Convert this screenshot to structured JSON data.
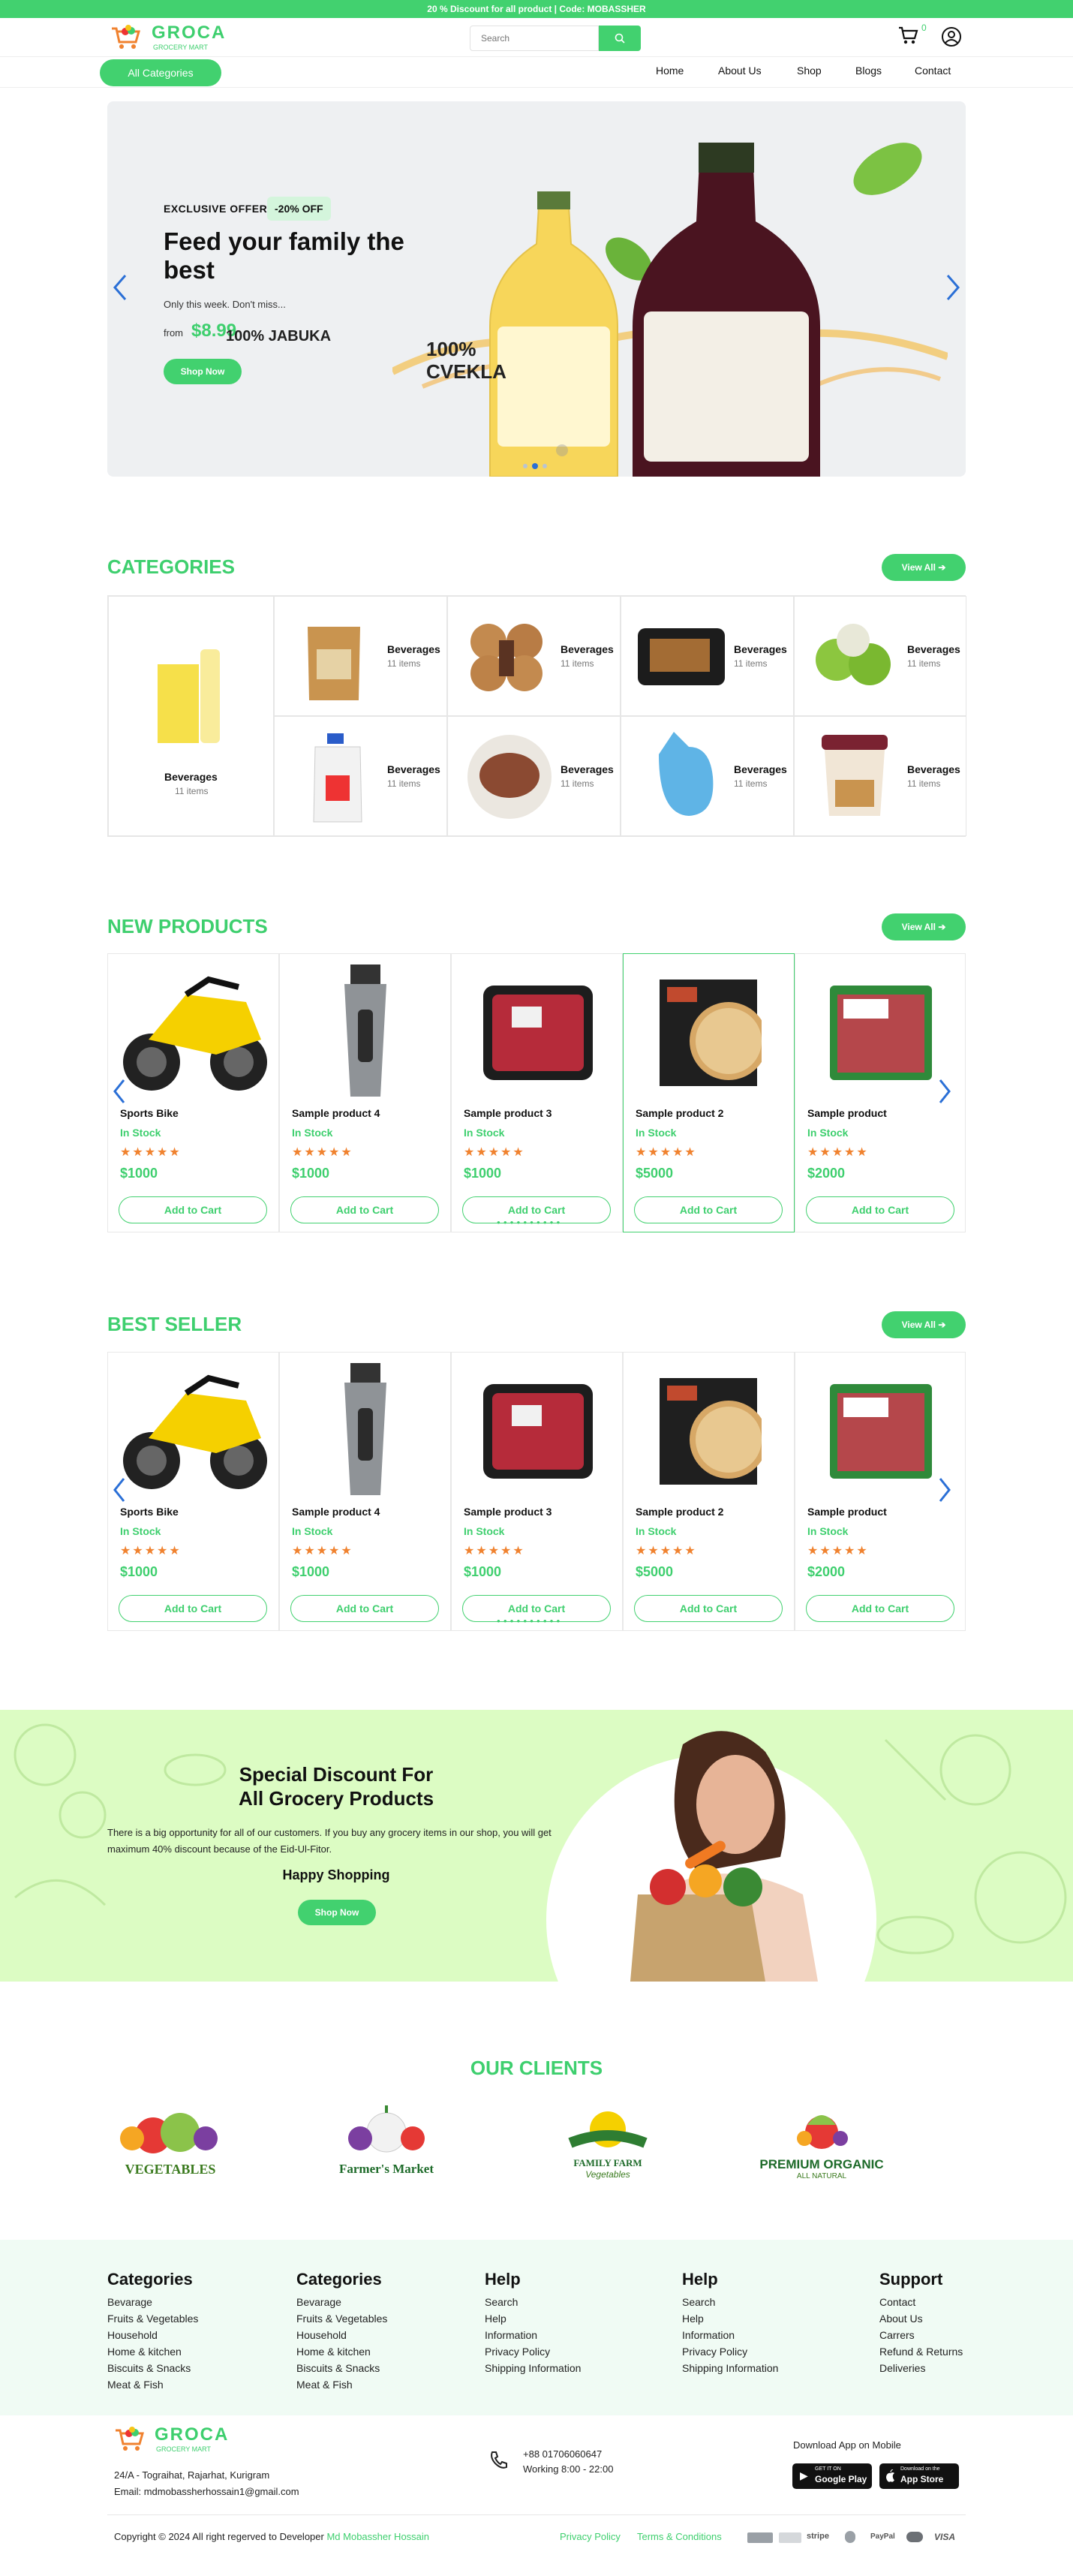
{
  "topbar": {
    "text": "20 % Discount for all product | Code: MOBASSHER"
  },
  "brand": {
    "name": "GROCA",
    "tagline": "GROCERY MART"
  },
  "search": {
    "placeholder": "Search"
  },
  "cart": {
    "count": "0"
  },
  "nav": {
    "all_categories": "All Categories",
    "links": [
      "Home",
      "About Us",
      "Shop",
      "Blogs",
      "Contact"
    ]
  },
  "hero": {
    "offer": "EXCLUSIVE OFFER",
    "badge": "-20% OFF",
    "title": "Feed your family the best",
    "subtitle": "Only this week. Don't miss...",
    "from_label": "from",
    "price": "$8.99",
    "button": "Shop Now",
    "bottle_left_text": "100% JABUKA",
    "bottle_right_text": "100% CVEKLA"
  },
  "categories": {
    "title": "CATEGORIES",
    "view_all": "View All",
    "items": [
      {
        "name": "Beverages",
        "count": "11 items"
      },
      {
        "name": "Beverages",
        "count": "11 items"
      },
      {
        "name": "Beverages",
        "count": "11 items"
      },
      {
        "name": "Beverages",
        "count": "11 items"
      },
      {
        "name": "Beverages",
        "count": "11 items"
      },
      {
        "name": "Beverages",
        "count": "11 items"
      },
      {
        "name": "Beverages",
        "count": "11 items"
      },
      {
        "name": "Beverages",
        "count": "11 items"
      },
      {
        "name": "Beverages",
        "count": "11 items"
      }
    ]
  },
  "new_products": {
    "title": "NEW PRODUCTS",
    "view_all": "View All",
    "items": [
      {
        "name": "Sports Bike",
        "stock": "In Stock",
        "stars": "★★★★★",
        "price": "$1000",
        "button": "Add to Cart"
      },
      {
        "name": "Sample product 4",
        "stock": "In Stock",
        "stars": "★★★★★",
        "price": "$1000",
        "button": "Add to Cart"
      },
      {
        "name": "Sample product 3",
        "stock": "In Stock",
        "stars": "★★★★★",
        "price": "$1000",
        "button": "Add to Cart"
      },
      {
        "name": "Sample product 2",
        "stock": "In Stock",
        "stars": "★★★★★",
        "price": "$5000",
        "button": "Add to Cart"
      },
      {
        "name": "Sample product",
        "stock": "In Stock",
        "stars": "★★★★★",
        "price": "$2000",
        "button": "Add to Cart"
      }
    ]
  },
  "best_seller": {
    "title": "BEST SELLER",
    "view_all": "View All",
    "items": [
      {
        "name": "Sports Bike",
        "stock": "In Stock",
        "stars": "★★★★★",
        "price": "$1000",
        "button": "Add to Cart"
      },
      {
        "name": "Sample product 4",
        "stock": "In Stock",
        "stars": "★★★★★",
        "price": "$1000",
        "button": "Add to Cart"
      },
      {
        "name": "Sample product 3",
        "stock": "In Stock",
        "stars": "★★★★★",
        "price": "$1000",
        "button": "Add to Cart"
      },
      {
        "name": "Sample product 2",
        "stock": "In Stock",
        "stars": "★★★★★",
        "price": "$5000",
        "button": "Add to Cart"
      },
      {
        "name": "Sample product",
        "stock": "In Stock",
        "stars": "★★★★★",
        "price": "$2000",
        "button": "Add to Cart"
      }
    ]
  },
  "promo": {
    "title_line1": "Special Discount For",
    "title_line2": "All Grocery Products",
    "body": "There is a big opportunity for all of our customers. If you buy any grocery items in our shop, you will get maximum 40% discount because of the Eid-Ul-Fitor.",
    "tagline": "Happy Shopping",
    "button": "Shop Now"
  },
  "clients": {
    "title": "OUR CLIENTS",
    "logos": [
      "VEGETABLES",
      "Farmer's Market",
      "FAMILY FARM",
      "PREMIUM ORGANIC"
    ],
    "subtexts": [
      "",
      "",
      "Vegetables",
      "ALL NATURAL"
    ]
  },
  "footer": {
    "columns": [
      {
        "title": "Categories",
        "items": [
          "Bevarage",
          "Fruits & Vegetables",
          "Household",
          "Home & kitchen",
          "Biscuits & Snacks",
          "Meat & Fish"
        ]
      },
      {
        "title": "Categories",
        "items": [
          "Bevarage",
          "Fruits & Vegetables",
          "Household",
          "Home & kitchen",
          "Biscuits & Snacks",
          "Meat & Fish"
        ]
      },
      {
        "title": "Help",
        "items": [
          "Search",
          "Help",
          "Information",
          "Privacy Policy",
          "Shipping Information"
        ]
      },
      {
        "title": "Help",
        "items": [
          "Search",
          "Help",
          "Information",
          "Privacy Policy",
          "Shipping Information"
        ]
      },
      {
        "title": "Support",
        "items": [
          "Contact",
          "About Us",
          "Carrers",
          "Refund & Returns",
          "Deliveries"
        ]
      }
    ]
  },
  "contact": {
    "address": "24/A - Tograihat, Rajarhat, Kurigram",
    "email": "Email: mdmobassherhossain1@gmail.com",
    "phone": "+88 01706060647",
    "hours": "Working 8:00 - 22:00",
    "app_label": "Download App on Mobile",
    "google_small": "GET IT ON",
    "google": "Google Play",
    "apple_small": "Download on the",
    "apple": "App Store"
  },
  "copyright": {
    "text": "Copyright © 2024 All right regerved to Developer",
    "developer": "Md Mobassher Hossain",
    "privacy": "Privacy Policy",
    "terms": "Terms & Conditions",
    "payments": [
      "stripe",
      "PayPal",
      "VISA"
    ]
  },
  "colors": {
    "accent": "#42d16f",
    "star": "#f0822f",
    "arrow": "#2a6fd6"
  }
}
